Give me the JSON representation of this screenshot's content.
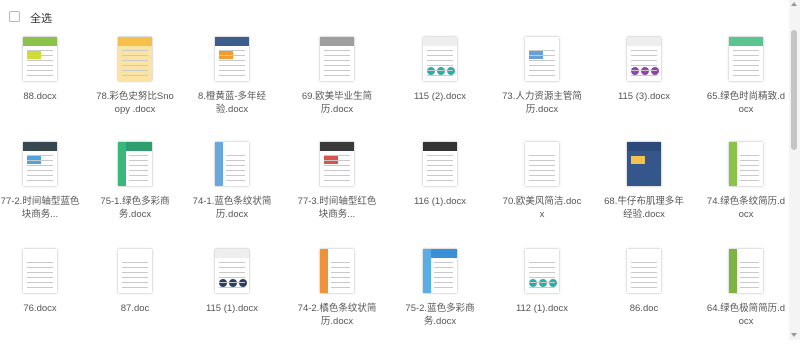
{
  "header": {
    "select_all_label": "全选"
  },
  "files": [
    {
      "name": "88.docx",
      "thumb": "green-collage"
    },
    {
      "name": "78.彩色史努比Snoopy .docx",
      "thumb": "yellow"
    },
    {
      "name": "8.橙黄蓝-多年经验.docx",
      "thumb": "blue-orange"
    },
    {
      "name": "69.欧美毕业生简历.docx",
      "thumb": "gray-table"
    },
    {
      "name": "115 (2).docx",
      "thumb": "teal-circles"
    },
    {
      "name": "73.人力资源主管简历.docx",
      "thumb": "plain-blue"
    },
    {
      "name": "115 (3).docx",
      "thumb": "purple-circles"
    },
    {
      "name": "65.绿色时尚精致.docx",
      "thumb": "green-top"
    },
    {
      "name": "77-2.时间轴型蓝色块商务...",
      "thumb": "dark-blue"
    },
    {
      "name": "75-1.绿色多彩商务.docx",
      "thumb": "green-side"
    },
    {
      "name": "74-1.蓝色条纹状简历.docx",
      "thumb": "blue-stripe"
    },
    {
      "name": "77-3.时间轴型红色块商务...",
      "thumb": "dark-red"
    },
    {
      "name": "116 (1).docx",
      "thumb": "black-top"
    },
    {
      "name": "70.欧美风简洁.docx",
      "thumb": "gray-plain"
    },
    {
      "name": "68.牛仔布肌理多年经验.docx",
      "thumb": "denim"
    },
    {
      "name": "74.绿色条纹简历.docx",
      "thumb": "green-stripe"
    },
    {
      "name": "76.docx",
      "thumb": "plain"
    },
    {
      "name": "87.doc",
      "thumb": "text"
    },
    {
      "name": "115 (1).docx",
      "thumb": "navy-circles"
    },
    {
      "name": "74-2.橘色条纹状简历.docx",
      "thumb": "orange-stripe"
    },
    {
      "name": "75-2.蓝色多彩商务.docx",
      "thumb": "blue-side"
    },
    {
      "name": "112 (1).docx",
      "thumb": "teal-grid"
    },
    {
      "name": "86.doc",
      "thumb": "text"
    },
    {
      "name": "64.绿色极简简历.docx",
      "thumb": "green-mini"
    }
  ],
  "colors": {
    "accent": "#3b8fd6",
    "filename_text": "#555555"
  }
}
